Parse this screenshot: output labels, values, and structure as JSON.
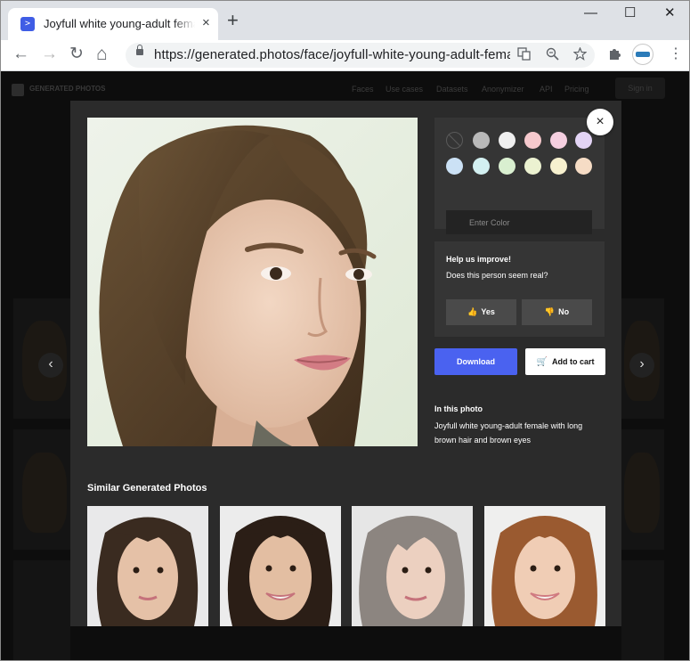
{
  "browser": {
    "tab_title": "Joyfull white young-adult female with long brown hair and brown eyes",
    "tab_favicon": ">",
    "tab_close": "×",
    "new_tab": "+",
    "minimize": "—",
    "maximize": "☐",
    "close": "✕",
    "back": "←",
    "forward": "→",
    "reload": "↻",
    "home": "⌂",
    "url": "https://generated.photos/face/joyfull-white-young-adult-female",
    "icons": [
      "translate-icon",
      "zoom-icon",
      "star-icon",
      "extensions-icon",
      "profile-avatar",
      "menu-icon"
    ]
  },
  "site": {
    "name": "GENERATED PHOTOS",
    "nav": [
      "Faces",
      "Use cases",
      "Datasets",
      "Anonymizer",
      "API",
      "Pricing"
    ],
    "signin": "Sign in"
  },
  "colors": {
    "accent": "#4a62f0",
    "swatches": [
      "none",
      "#b9b9b9",
      "#efefef",
      "#f6c9cd",
      "#f5cfe0",
      "#e3d4f5",
      "#cbe1f5",
      "#d3f0f1",
      "#d9efd0",
      "#ecf2d1",
      "#f7f1cf",
      "#f6dcc5"
    ]
  },
  "color_filter": {
    "placeholder": "Enter Color"
  },
  "feedback": {
    "title": "Help us improve!",
    "question": "Does this person seem real?",
    "yes": "Yes",
    "no": "No"
  },
  "actions": {
    "download": "Download",
    "add_to_cart": "Add to cart"
  },
  "in_this_photo": {
    "heading": "In this photo",
    "description": "Joyfull white young-adult female with long brown hair and brown eyes"
  },
  "similar": {
    "heading": "Similar Generated Photos",
    "count_visible": 4
  },
  "modal_controls": {
    "close": "×",
    "prev": "‹",
    "next": "›"
  }
}
